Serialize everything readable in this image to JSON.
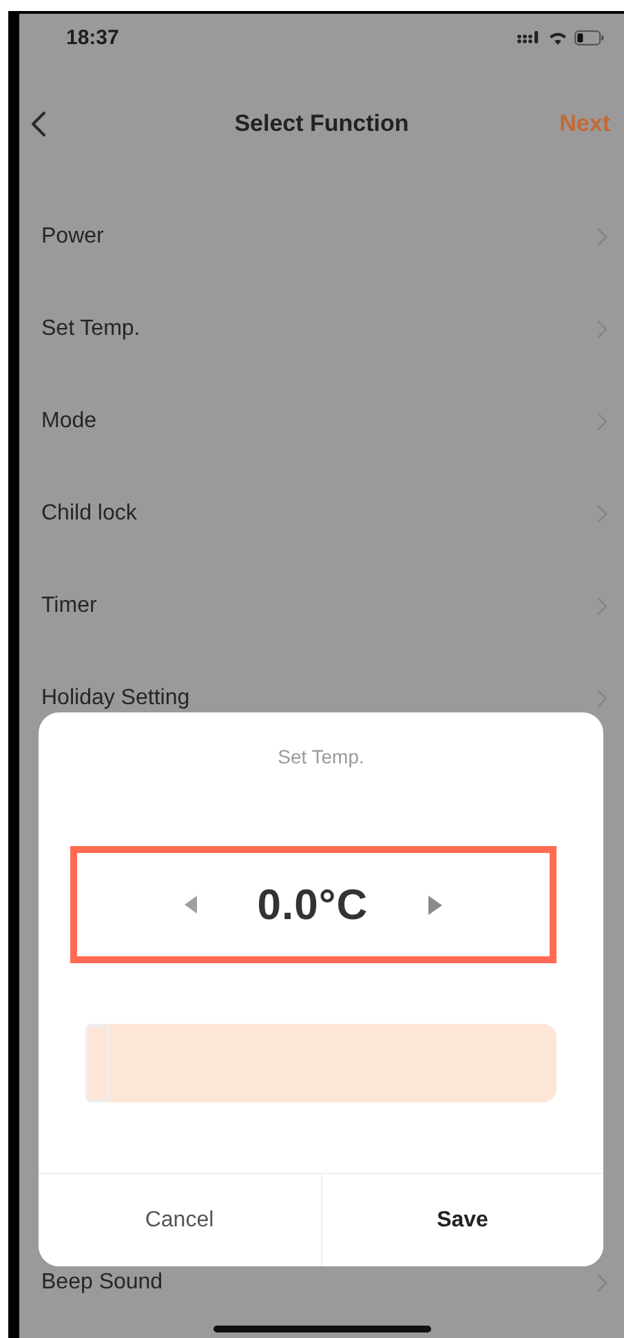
{
  "status_bar": {
    "time": "18:37"
  },
  "nav": {
    "title": "Select Function",
    "action": "Next"
  },
  "functions": [
    {
      "label": "Power"
    },
    {
      "label": "Set Temp."
    },
    {
      "label": "Mode"
    },
    {
      "label": "Child lock"
    },
    {
      "label": "Timer"
    },
    {
      "label": "Holiday Setting"
    },
    {
      "label": "Beep Sound"
    }
  ],
  "dialog": {
    "title": "Set Temp.",
    "value": "0.0°C",
    "slider": {
      "level": 0
    },
    "buttons": [
      {
        "label": "Cancel",
        "kind": "cancel"
      },
      {
        "label": "Save",
        "kind": "confirm"
      }
    ]
  }
}
